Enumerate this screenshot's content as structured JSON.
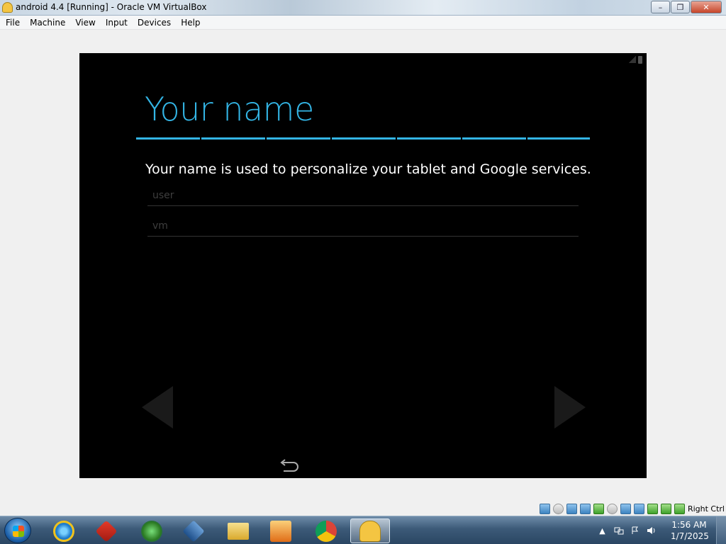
{
  "window": {
    "title": "android 4.4 [Running] - Oracle VM VirtualBox",
    "minimize_label": "–",
    "restore_label": "❐",
    "close_label": "✕"
  },
  "menu": {
    "items": [
      "File",
      "Machine",
      "View",
      "Input",
      "Devices",
      "Help"
    ]
  },
  "android": {
    "title": "Your name",
    "description": "Your name is used to personalize your tablet and Google services.",
    "first_name": {
      "value": "",
      "placeholder": "user"
    },
    "last_name": {
      "value": "",
      "placeholder": "vm"
    },
    "accent_color": "#33b5e5"
  },
  "vbox_status": {
    "host_key": "Right Ctrl",
    "icons": [
      "hard-disk-icon",
      "optical-drive-icon",
      "audio-icon",
      "network-icon",
      "usb-icon",
      "shared-folder-icon",
      "display-icon",
      "video-capture-icon",
      "mouse-integration-icon",
      "vt-x-icon",
      "cpu-icon"
    ]
  },
  "taskbar": {
    "apps": [
      "start-button",
      "internet-explorer",
      "red-app",
      "globe-app",
      "virtualbox",
      "file-explorer",
      "media-player",
      "chrome",
      "android-vm"
    ],
    "tray_chevron": "▲",
    "time": "1:56 AM",
    "date": "1/7/2025"
  }
}
